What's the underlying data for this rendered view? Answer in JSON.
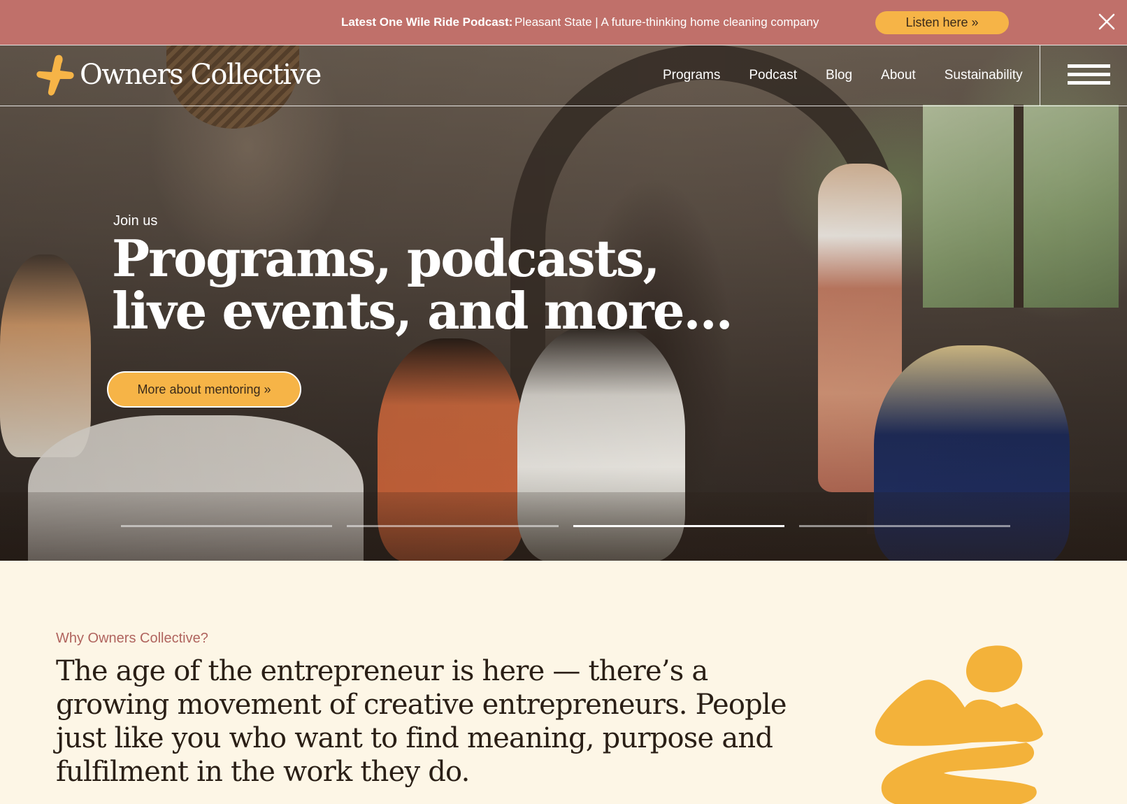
{
  "announcement": {
    "label": "Latest One Wile Ride Podcast:",
    "text": "Pleasant State | A future-thinking home cleaning company",
    "cta": "Listen here »",
    "close_icon": "close-icon"
  },
  "nav": {
    "logo_text": "Owners Collective",
    "logo_icon": "star-logo-icon",
    "links": [
      "Programs",
      "Podcast",
      "Blog",
      "About",
      "Sustainability"
    ],
    "menu_icon": "hamburger-menu-icon"
  },
  "hero": {
    "eyebrow": "Join us",
    "title_line1": "Programs, podcasts,",
    "title_line2": "live events, and more...",
    "cta": "More about mentoring »",
    "slides_total": 4,
    "active_slide": 3
  },
  "why": {
    "label": "Why Owners Collective?",
    "text": "The age of the entrepreneur is here — there’s a growing movement of creative entrepreneurs. People just like you who want to find meaning, purpose and fulfilment in the work they do."
  },
  "colors": {
    "announce_bg": "#c0706a",
    "accent": "#f6b447",
    "page_bg": "#fdf6e6",
    "label": "#b0645e",
    "text": "#2a1f16"
  }
}
